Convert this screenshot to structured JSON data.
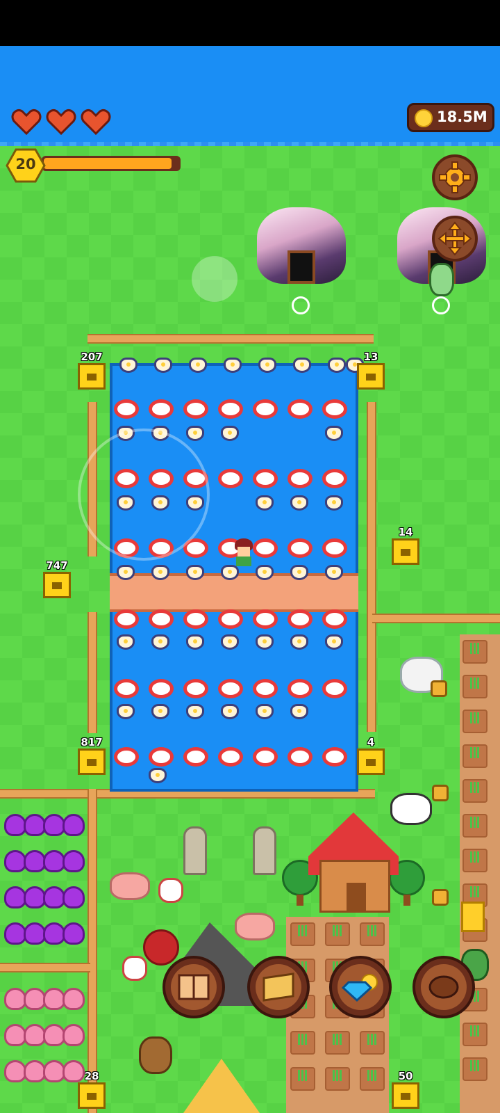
{
  "hud": {
    "hearts": 3,
    "coins": "18.5M",
    "level": "20",
    "xp_progress": 0.95,
    "settings_icon": "gear-icon",
    "move_icon": "move-arrows-icon"
  },
  "hives": {
    "top_left": "207",
    "top_right": "13",
    "mid_right": "14",
    "left": "747",
    "bottom_left": "817",
    "bottom_right": "4",
    "bottom_far_left": "28",
    "bottom_right2": "50"
  },
  "actions": [
    {
      "name": "book-button",
      "icon": "book-icon"
    },
    {
      "name": "map-button",
      "icon": "map-scroll-icon"
    },
    {
      "name": "shop-button",
      "icon": "gem-coin-icon"
    },
    {
      "name": "meat-button",
      "icon": "meat-icon"
    }
  ],
  "colors": {
    "sky": "#1a8ef5",
    "grass": "#5ed94a",
    "accent": "#ffa51e",
    "panel": "#6b2e1c"
  }
}
